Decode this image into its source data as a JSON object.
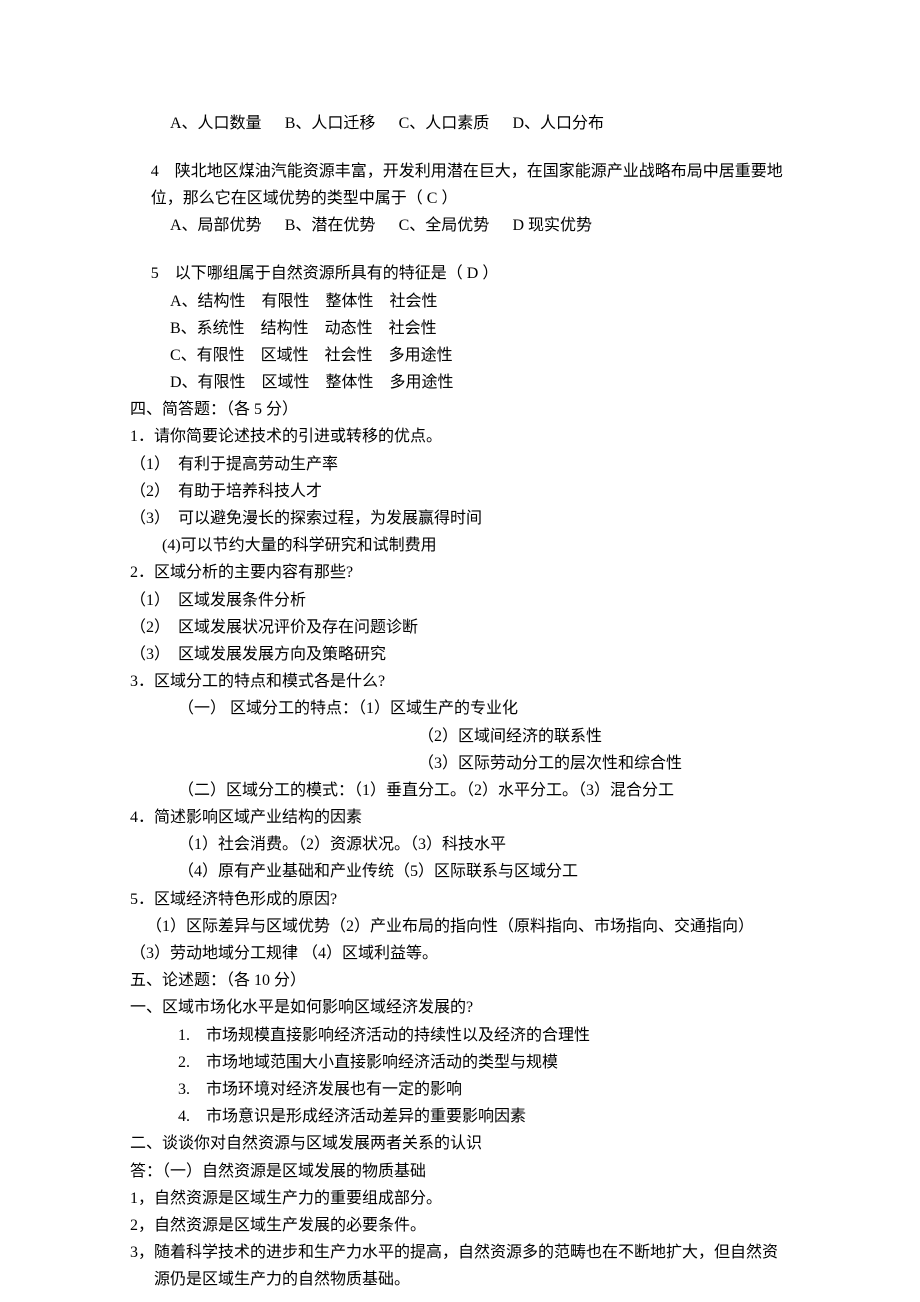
{
  "q_prev": {
    "opts": {
      "a": "A、人口数量",
      "b": "B、人口迁移",
      "c": "C、人口素质",
      "d": "D、人口分布"
    }
  },
  "q4": {
    "text": "4　陕北地区煤油汽能资源丰富，开发利用潜在巨大，在国家能源产业战略布局中居重要地位，那么它在区域优势的类型中属于（ C ）",
    "opts": {
      "a": "A、局部优势",
      "b": "B、潜在优势",
      "c": "C、全局优势",
      "d": "D  现实优势"
    }
  },
  "q5": {
    "text": "5　以下哪组属于自然资源所具有的特征是（ D ）",
    "opts": {
      "a": "A、结构性　有限性　整体性　社会性",
      "b": "B、系统性　结构性　动态性　社会性",
      "c": "C、有限性　区域性　社会性　多用途性",
      "d": "D、有限性　区域性　整体性　多用途性"
    }
  },
  "section4": {
    "title": "四、简答题：（各 5 分）",
    "q1": {
      "text": "1．请你简要论述技术的引进或转移的优点。",
      "a": "（1）　有利于提高劳动生产率",
      "b": "（2）　有助于培养科技人才",
      "c": "（3）　可以避免漫长的探索过程，为发展赢得时间",
      "d": "(4)可以节约大量的科学研究和试制费用"
    },
    "q2": {
      "text": "2．区域分析的主要内容有那些?",
      "a": "（1）　区域发展条件分析",
      "b": "（2）　区域发展状况评价及存在问题诊断",
      "c": "（3）　区域发展发展方向及策略研究"
    },
    "q3": {
      "text": "3．区域分工的特点和模式各是什么?",
      "p1": "（一） 区域分工的特点：（1）区域生产的专业化",
      "p2": "（2）区域间经济的联系性",
      "p3": "（3）区际劳动分工的层次性和综合性",
      "p4": "（二）区域分工的模式：（1）垂直分工。（2）水平分工。（3）混合分工"
    },
    "q4": {
      "text": "4．简述影响区域产业结构的因素",
      "a": "（1）社会消费。（2）资源状况。（3）科技水平",
      "b": "（4）原有产业基础和产业传统（5）区际联系与区域分工"
    },
    "q5": {
      "text": "5．区域经济特色形成的原因?",
      "a": "（1）区际差异与区域优势（2）产业布局的指向性（原料指向、市场指向、交通指向）",
      "b": "（3）劳动地域分工规律 （4）区域利益等。"
    }
  },
  "section5": {
    "title": "五、论述题：（各 10 分）",
    "q1": {
      "text": "一、区域市场化水平是如何影响区域经济发展的?",
      "a": "1.　市场规模直接影响经济活动的持续性以及经济的合理性",
      "b": "2.　市场地域范围大小直接影响经济活动的类型与规模",
      "c": "3.　市场环境对经济发展也有一定的影响",
      "d": "4.　市场意识是形成经济活动差异的重要影响因素"
    },
    "q2": {
      "text": "二、谈谈你对自然资源与区域发展两者关系的认识",
      "ans": "答：（一）自然资源是区域发展的物质基础",
      "a": "1，自然资源是区域生产力的重要组成部分。",
      "b": "2，自然资源是区域生产发展的必要条件。",
      "c": "3，随着科学技术的进步和生产力水平的提高，自然资源多的范畴也在不断地扩大，但自然资源仍是区域生产力的自然物质基础。"
    }
  }
}
